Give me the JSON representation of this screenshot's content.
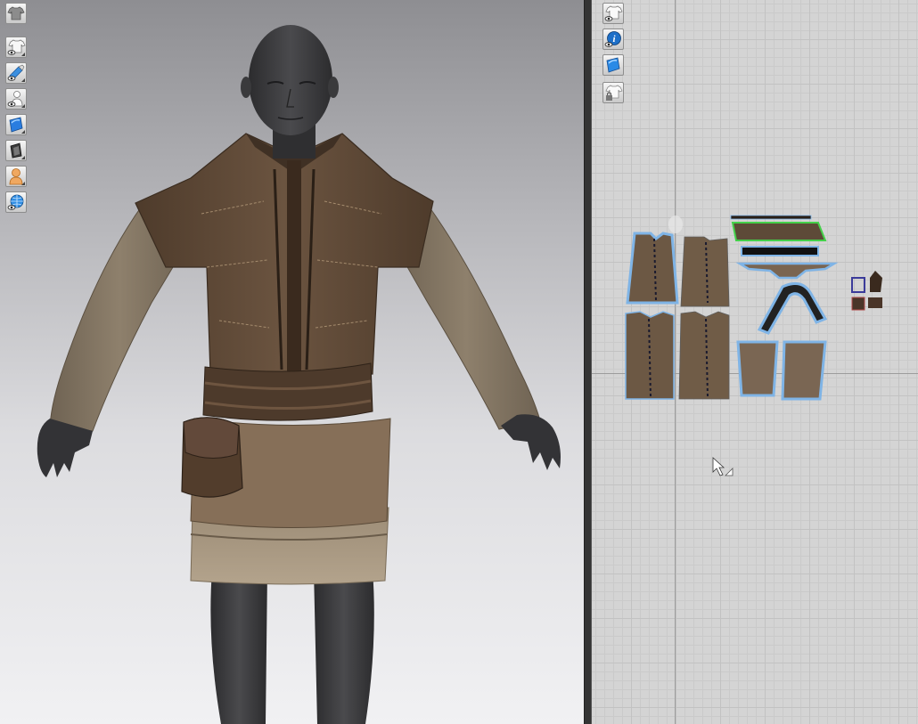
{
  "app": {
    "title": ""
  },
  "viewport3d": {
    "background_top": "#8e8e92",
    "background_bottom": "#f1f1f3",
    "toolbar": [
      {
        "name": "show-garment-toggle",
        "icon": "shirt-icon"
      },
      {
        "name": "show-garment-visibility",
        "icon": "shirt-eye-icon"
      },
      {
        "name": "show-tools",
        "icon": "tools-eye-icon"
      },
      {
        "name": "show-avatar",
        "icon": "avatar-eye-icon"
      },
      {
        "name": "texture-mode",
        "icon": "texture-icon"
      },
      {
        "name": "render-style",
        "icon": "render-style-icon"
      },
      {
        "name": "avatar-style",
        "icon": "avatar-skin-icon"
      },
      {
        "name": "environment",
        "icon": "globe-icon"
      }
    ],
    "colors": {
      "avatar": "#3b3b3d",
      "vest": "#5c4633",
      "tunic": "#8b7c67",
      "belt": "#4a3628",
      "skirt": "#a89882"
    }
  },
  "viewport2d": {
    "background": "#d4d4d4",
    "grid_color": "#c2c2c2",
    "toolbar": [
      {
        "name": "show-2d-garment",
        "icon": "shirt-eye-icon"
      },
      {
        "name": "show-info",
        "icon": "info-icon"
      },
      {
        "name": "show-texture",
        "icon": "texture-icon"
      },
      {
        "name": "lock-pattern",
        "icon": "shirt-lock-icon"
      }
    ],
    "colors": {
      "piece_fill": "#6e5a46",
      "outline_selected": "#7fb4e6",
      "seam": "#1a1a2e",
      "sewing_line": "#44d04a"
    }
  }
}
